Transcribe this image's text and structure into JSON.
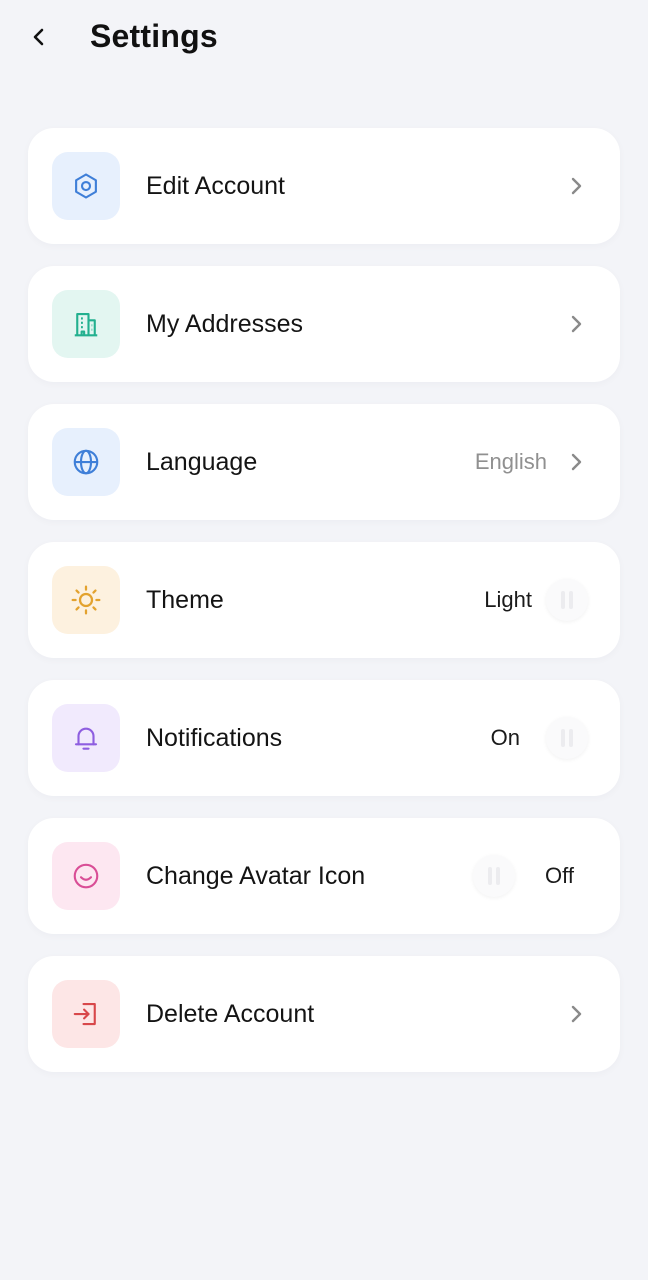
{
  "header": {
    "title": "Settings"
  },
  "colors": {
    "edit_account_bg": "#e7f0fd",
    "edit_account_icon": "#3f7fd8",
    "addresses_bg": "#e3f6f1",
    "addresses_icon": "#23b08f",
    "language_bg": "#e7f0fd",
    "language_icon": "#3f7fd8",
    "theme_bg": "#fdf1df",
    "theme_icon": "#e3a22e",
    "notifications_bg": "#f1eafd",
    "notifications_icon": "#8e5ee0",
    "avatar_bg": "#fde7f1",
    "avatar_icon": "#d94e96",
    "delete_bg": "#fde6e6",
    "delete_icon": "#d8474a"
  },
  "items": [
    {
      "id": "edit-account",
      "label": "Edit Account",
      "icon": "gear-icon"
    },
    {
      "id": "my-addresses",
      "label": "My Addresses",
      "icon": "building-icon"
    },
    {
      "id": "language",
      "label": "Language",
      "value": "English",
      "icon": "globe-icon"
    },
    {
      "id": "theme",
      "label": "Theme",
      "value": "Light",
      "icon": "sun-icon"
    },
    {
      "id": "notifications",
      "label": "Notifications",
      "value": "On",
      "icon": "bell-icon"
    },
    {
      "id": "change-avatar-icon",
      "label": "Change Avatar Icon",
      "value": "Off",
      "icon": "smile-icon"
    },
    {
      "id": "delete-account",
      "label": "Delete Account",
      "icon": "logout-icon"
    }
  ]
}
